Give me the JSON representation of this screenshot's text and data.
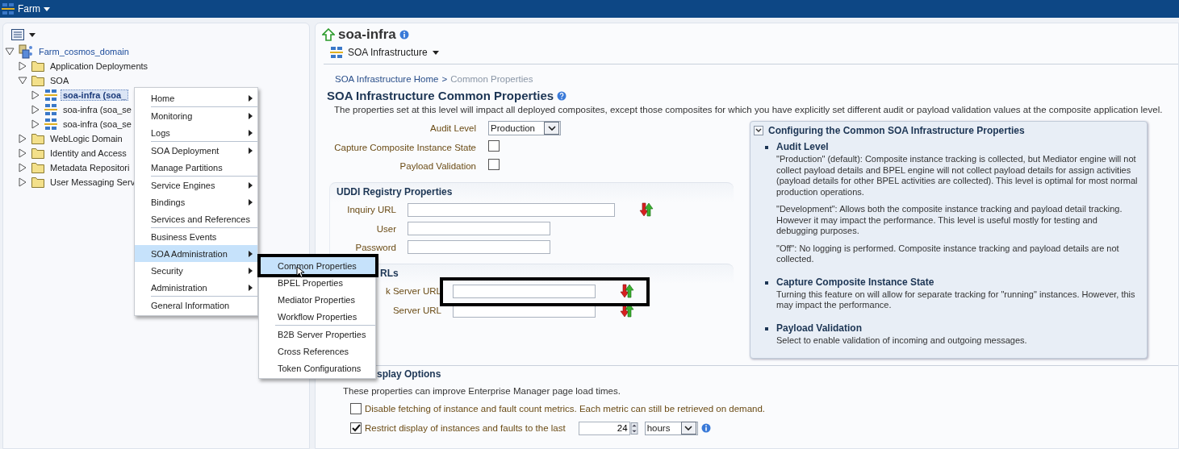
{
  "top_bar": {
    "title": "Farm"
  },
  "tree": [
    {
      "label": "Farm_cosmos_domain",
      "kind": "farm",
      "expanded": true,
      "selected": false,
      "children": [
        {
          "label": "Application Deployments",
          "kind": "folder",
          "expanded": false,
          "selected": false
        },
        {
          "label": "SOA",
          "kind": "folder",
          "expanded": true,
          "selected": false,
          "children": [
            {
              "label": "soa-infra (soa_",
              "kind": "soa",
              "expanded": false,
              "selected": true
            },
            {
              "label": "soa-infra (soa_se",
              "kind": "soa",
              "expanded": false,
              "selected": false
            },
            {
              "label": "soa-infra (soa_se",
              "kind": "soa",
              "expanded": false,
              "selected": false
            }
          ]
        },
        {
          "label": "WebLogic Domain",
          "kind": "folder",
          "expanded": false,
          "selected": false
        },
        {
          "label": "Identity and Access",
          "kind": "folder",
          "expanded": false,
          "selected": false
        },
        {
          "label": "Metadata Repositori",
          "kind": "folder",
          "expanded": false,
          "selected": false
        },
        {
          "label": "User Messaging Serv",
          "kind": "folder",
          "expanded": false,
          "selected": false
        }
      ]
    }
  ],
  "page_header": {
    "title": "soa-infra",
    "target_menu": "SOA Infrastructure"
  },
  "breadcrumb": [
    {
      "label": "SOA Infrastructure Home",
      "current": false
    },
    {
      "label": "Common Properties",
      "current": true
    }
  ],
  "separator": ">",
  "heading": "SOA Infrastructure Common Properties",
  "description": "The properties set at this level will impact all deployed composites, except those composites for which you have explicitly set different audit or payload validation values at the composite application level.",
  "settings": [
    {
      "kind": "select",
      "label": "Audit Level",
      "value": "Production"
    },
    {
      "kind": "checkbox",
      "label": "Capture Composite Instance State",
      "checked": false
    },
    {
      "kind": "checkbox",
      "label": "Payload Validation",
      "checked": false
    }
  ],
  "uddi": {
    "title": "UDDI Registry Properties",
    "fields": [
      {
        "label": "Inquiry URL",
        "kind": "long"
      },
      {
        "label": "User",
        "kind": "short"
      },
      {
        "label": "Password",
        "kind": "short"
      }
    ]
  },
  "urls": {
    "title": "RLs",
    "fields": [
      {
        "label": "k Server URL"
      },
      {
        "label": "Server URL"
      }
    ]
  },
  "help": {
    "title": "Configuring the Common SOA Infrastructure Properties",
    "expanded": true,
    "items": [
      {
        "title": "Audit Level",
        "paragraphs": [
          "\"Production\" (default): Composite instance tracking is collected, but Mediator engine will not collect payload details and BPEL engine will not collect payload details for assign activities (payload details for other BPEL activities are collected). This level is optimal for most normal production operations.",
          "\"Development\": Allows both the composite instance tracking and payload detail tracking. However it may impact the performance. This level is useful mostly for testing and debugging purposes.",
          "\"Off\": No logging is performed. Composite instance tracking and payload details are not collected."
        ]
      },
      {
        "title": "Capture Composite Instance State",
        "paragraphs": [
          "Turning this feature on will allow for separate tracking for \"running\" instances. However, this may impact the performance."
        ]
      },
      {
        "title": "Payload Validation",
        "paragraphs": [
          "Select to enable validation of incoming and outgoing messages."
        ]
      }
    ]
  },
  "display_options": {
    "title": "splay Options",
    "description": "These properties can improve Enterprise Manager page load times.",
    "options": [
      {
        "kind": "checkbox",
        "label": "Disable fetching of instance and fault count metrics. Each metric can still be retrieved on demand.",
        "checked": false
      },
      {
        "kind": "duration",
        "label": "Restrict display of instances and faults to the last",
        "checked": true,
        "value": "24",
        "unit": "hours"
      }
    ]
  },
  "context_menu": [
    [
      {
        "label": "Home",
        "submenu": true,
        "selected": false
      }
    ],
    [
      {
        "label": "Monitoring",
        "submenu": true,
        "selected": false
      },
      {
        "label": "Logs",
        "submenu": true,
        "selected": false
      }
    ],
    [
      {
        "label": "SOA Deployment",
        "submenu": true,
        "selected": false
      },
      {
        "label": "Manage Partitions",
        "submenu": false,
        "selected": false
      }
    ],
    [
      {
        "label": "Service Engines",
        "submenu": true,
        "selected": false
      },
      {
        "label": "Bindings",
        "submenu": true,
        "selected": false
      },
      {
        "label": "Services and References",
        "submenu": false,
        "selected": false
      }
    ],
    [
      {
        "label": "Business Events",
        "submenu": false,
        "selected": false
      },
      {
        "label": "SOA Administration",
        "submenu": true,
        "selected": true
      },
      {
        "label": "Security",
        "submenu": true,
        "selected": false
      },
      {
        "label": "Administration",
        "submenu": true,
        "selected": false
      }
    ],
    [
      {
        "label": "General Information",
        "submenu": false,
        "selected": false
      }
    ]
  ],
  "submenu": [
    [
      {
        "label": "Common Properties",
        "selected": true
      },
      {
        "label": "BPEL Properties",
        "selected": false
      },
      {
        "label": "Mediator Properties",
        "selected": false
      },
      {
        "label": "Workflow Properties",
        "selected": false
      }
    ],
    [
      {
        "label": "B2B Server Properties",
        "selected": false
      },
      {
        "label": "Cross References",
        "selected": false
      },
      {
        "label": "Token Configurations",
        "selected": false
      }
    ]
  ]
}
